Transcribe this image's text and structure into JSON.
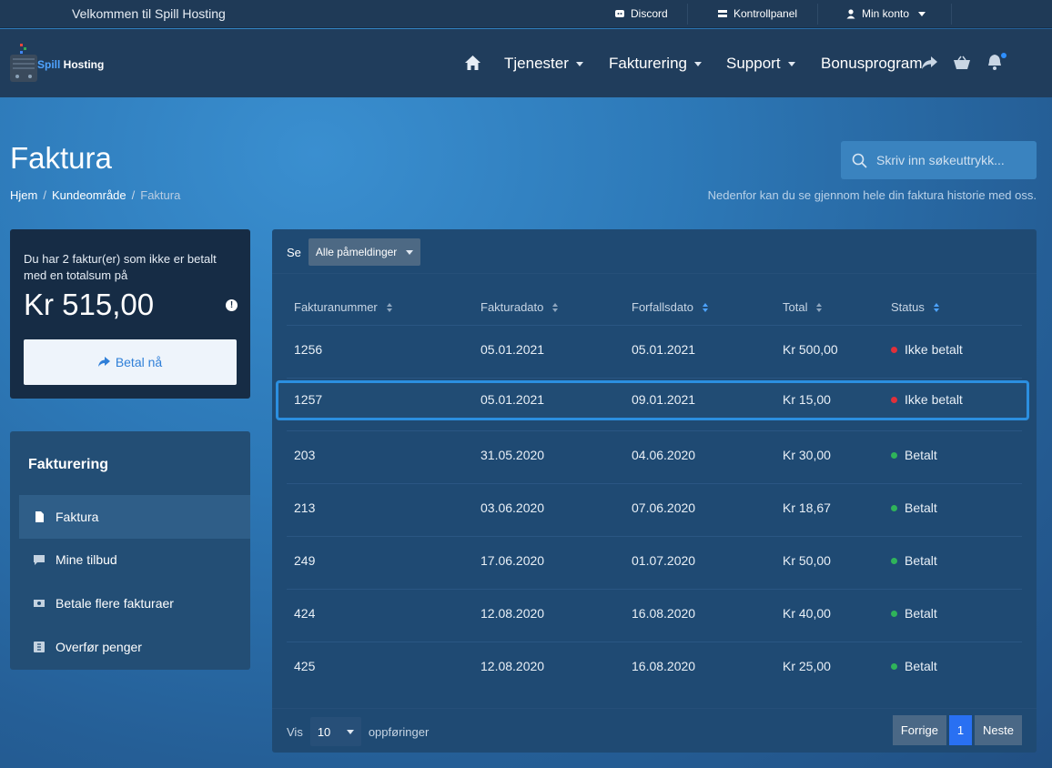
{
  "topbar": {
    "welcome": "Velkommen til Spill Hosting",
    "links": {
      "discord": "Discord",
      "panel": "Kontrollpanel",
      "account": "Min konto"
    }
  },
  "brand": {
    "name_a": "Spill",
    "name_b": " Hosting"
  },
  "nav": {
    "services": "Tjenester",
    "billing": "Fakturering",
    "support": "Support",
    "bonus": "Bonusprogram"
  },
  "header": {
    "title": "Faktura",
    "breadcrumb": [
      "Hjem",
      "Kundeområde",
      "Faktura"
    ],
    "subtitle": "Nedenfor kan du se gjennom hele din faktura historie med oss.",
    "search_placeholder": "Skriv inn søkeuttrykk..."
  },
  "due": {
    "text": "Du har 2 faktur(er) som ikke er betalt med en totalsum på",
    "amount": "Kr 515,00",
    "pay_label": "Betal nå"
  },
  "billing_menu": {
    "title": "Fakturering",
    "items": [
      "Faktura",
      "Mine tilbud",
      "Betale flere fakturaer",
      "Overfør penger"
    ]
  },
  "table": {
    "filter_label": "Se",
    "filter_value": "Alle påmeldinger",
    "headers": [
      "Fakturanummer",
      "Fakturadato",
      "Forfallsdato",
      "Total",
      "Status"
    ],
    "rows": [
      {
        "num": "1256",
        "date": "05.01.2021",
        "due": "05.01.2021",
        "total": "Kr 500,00",
        "status": "Ikke betalt",
        "paid": false
      },
      {
        "num": "1257",
        "date": "05.01.2021",
        "due": "09.01.2021",
        "total": "Kr 15,00",
        "status": "Ikke betalt",
        "paid": false
      },
      {
        "num": "203",
        "date": "31.05.2020",
        "due": "04.06.2020",
        "total": "Kr 30,00",
        "status": "Betalt",
        "paid": true
      },
      {
        "num": "213",
        "date": "03.06.2020",
        "due": "07.06.2020",
        "total": "Kr 18,67",
        "status": "Betalt",
        "paid": true
      },
      {
        "num": "249",
        "date": "17.06.2020",
        "due": "01.07.2020",
        "total": "Kr 50,00",
        "status": "Betalt",
        "paid": true
      },
      {
        "num": "424",
        "date": "12.08.2020",
        "due": "16.08.2020",
        "total": "Kr 40,00",
        "status": "Betalt",
        "paid": true
      },
      {
        "num": "425",
        "date": "12.08.2020",
        "due": "16.08.2020",
        "total": "Kr 25,00",
        "status": "Betalt",
        "paid": true
      }
    ],
    "show_label": "Vis",
    "show_value": "10",
    "show_suffix": "oppføringer",
    "prev": "Forrige",
    "page": "1",
    "next": "Neste"
  },
  "colors": {
    "unpaid": "#e0303a",
    "paid": "#2fb45a",
    "accent": "#2970f2"
  }
}
